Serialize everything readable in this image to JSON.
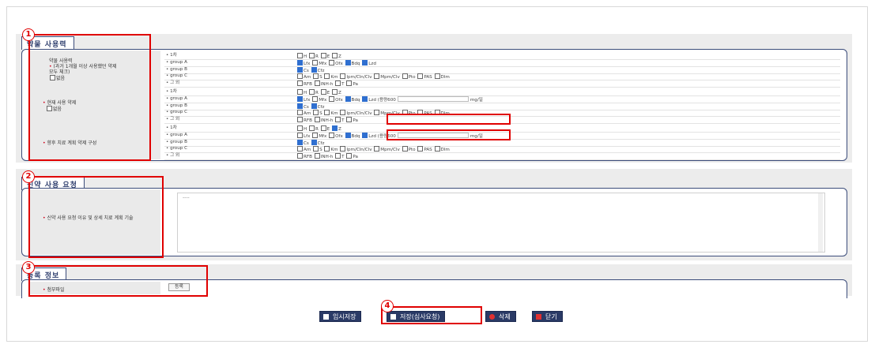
{
  "sections": {
    "s1_title": "약물 사용력",
    "s2_title": "신약 사용 요청",
    "s3_title": "등록 정보"
  },
  "markers": [
    "1",
    "2",
    "3",
    "4"
  ],
  "s1": {
    "usage_label_lines": [
      "약물 사용력",
      "(과거 1개월 이상 사용했던 약제",
      "모두 체크)"
    ],
    "current_label": "현재 사용 약제",
    "plan_label": "향후 치료 계획 약제 구성",
    "none_label": "없음",
    "group_labels": [
      "1차",
      "group A",
      "group B",
      "group C",
      "그 외"
    ],
    "line1": [
      "H",
      "R",
      "E",
      "Z"
    ],
    "groupA": [
      "Lfx",
      "Mfx",
      "Ofx",
      "Bdq",
      "Lzd"
    ],
    "groupB": [
      "Cs",
      "Cfz"
    ],
    "groupC": [
      "Am",
      "S",
      "Km",
      "Ipm/Cln/Clv",
      "Mpm/Clv",
      "Pto",
      "PAS",
      "Dlm"
    ],
    "other": [
      "RFB",
      "INH-h",
      "T",
      "Pa"
    ],
    "lzd_dose": "Lzd (용량600",
    "dose_unit": "mg/일"
  },
  "s2": {
    "label": "신약 사용 요청 이유 및 상세 치료 계획 기술",
    "text_value": "----"
  },
  "s3": {
    "label": "첨부파일",
    "register_button": "등록"
  },
  "buttons": {
    "temp_save": "임시저장",
    "save": "저장(심사요청)",
    "delete": "삭제",
    "close": "닫기"
  },
  "colors": {
    "accent": "#2a3a66",
    "highlight": "#e00000",
    "checked": "#2f6fd0"
  }
}
